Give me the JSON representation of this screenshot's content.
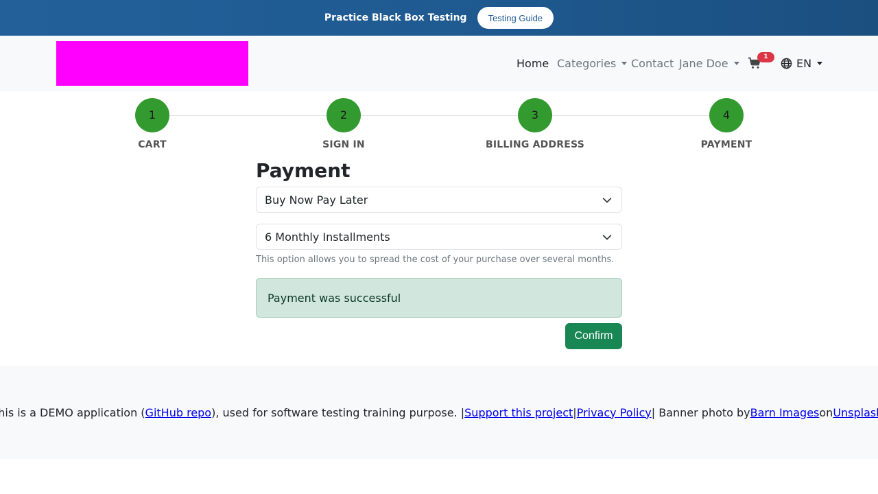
{
  "banner": {
    "text": "Practice Black Box Testing",
    "button_label": "Testing Guide"
  },
  "nav": {
    "home": "Home",
    "categories": "Categories",
    "contact": "Contact",
    "user": "Jane Doe",
    "cart_count": "1",
    "language": "EN"
  },
  "steps": [
    {
      "number": "1",
      "label": "CART"
    },
    {
      "number": "2",
      "label": "SIGN IN"
    },
    {
      "number": "3",
      "label": "BILLING ADDRESS"
    },
    {
      "number": "4",
      "label": "PAYMENT"
    }
  ],
  "payment": {
    "title": "Payment",
    "method_value": "Buy Now Pay Later",
    "plan_value": "6 Monthly Installments",
    "help_text": "This option allows you to spread the cost of your purchase over several months.",
    "alert_text": "Payment was successful",
    "confirm_label": "Confirm"
  },
  "footer": {
    "text_1": "This is a DEMO application (",
    "link_github": "GitHub repo",
    "text_2": "), used for software testing training purpose. | ",
    "link_support": "Support this project",
    "text_3": " | ",
    "link_privacy": "Privacy Policy",
    "text_4": " | Banner photo by ",
    "link_barn": "Barn Images",
    "text_5": " on ",
    "link_unsplash": "Unsplash",
    "text_6": "."
  },
  "colors": {
    "banner": "#1f5a91",
    "step_complete": "#339a2f",
    "alert_bg": "#d1e7dd",
    "confirm_bg": "#198754",
    "badge": "#dc3545",
    "logo_placeholder": "#ff00ff"
  },
  "icons": {
    "cart": "cart-icon",
    "language": "globe-icon",
    "select_arrow": "chevron-down-icon"
  }
}
